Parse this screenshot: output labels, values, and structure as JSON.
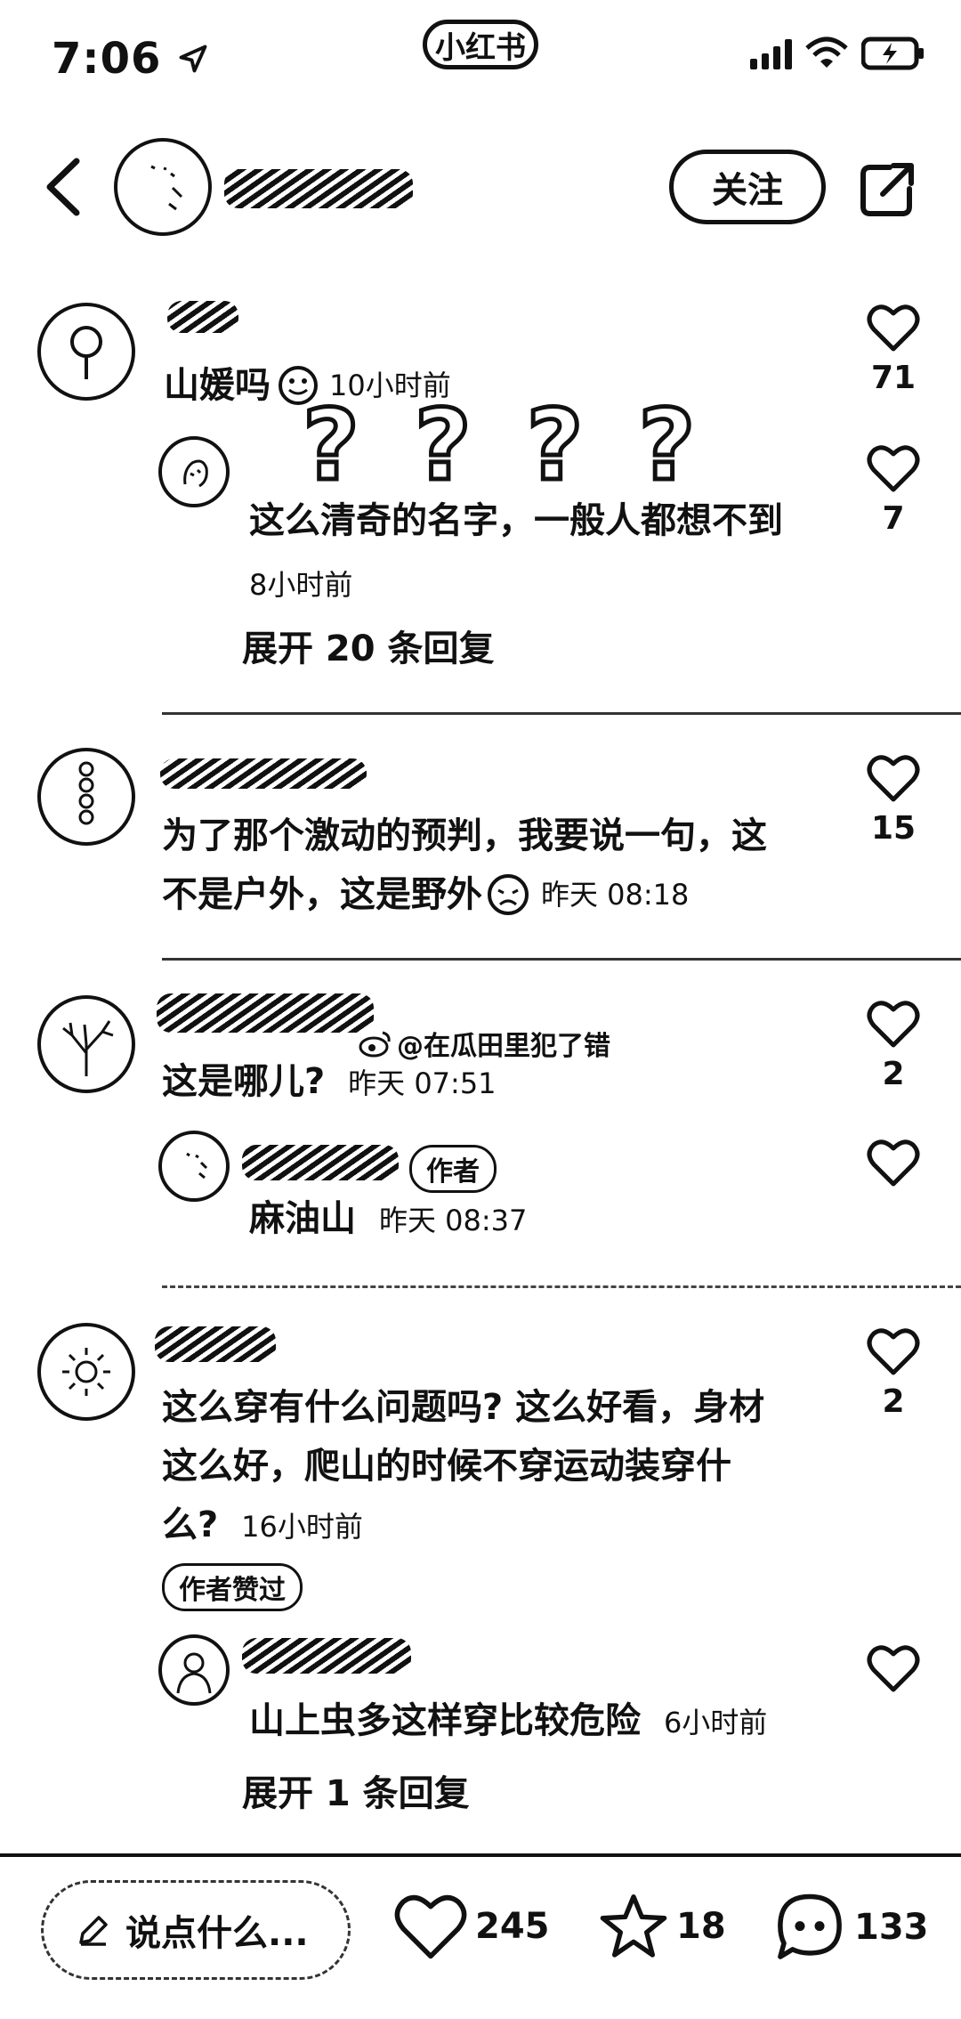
{
  "status_bar": {
    "time": "7:06",
    "app_badge": "小红书"
  },
  "header": {
    "follow_label": "关注"
  },
  "comments": [
    {
      "text": "山媛吗",
      "time": "10小时前",
      "likes": "71",
      "reply": {
        "text": "这么清奇的名字，一般人都想不到",
        "time": "8小时前",
        "likes": "7"
      },
      "expand": "展开 20 条回复"
    },
    {
      "text_line1": "为了那个激动的预判，我要说一句，这",
      "text_line2": "不是户外，这是野外",
      "time": "昨天 08:18",
      "likes": "15"
    },
    {
      "mention": "@在瓜田里犯了错",
      "text": "这是哪儿?",
      "time": "昨天 07:51",
      "likes": "2",
      "reply": {
        "badge": "作者",
        "text": "麻油山",
        "time": "昨天 08:37"
      }
    },
    {
      "text_line1": "这么穿有什么问题吗? 这么好看，身材",
      "text_line2": "这么好，爬山的时候不穿运动装穿什",
      "text_line3": "么?",
      "time": "16小时前",
      "likes": "2",
      "liked_badge": "作者赞过",
      "reply": {
        "text": "山上虫多这样穿比较危险",
        "time": "6小时前"
      },
      "expand": "展开 1 条回复"
    }
  ],
  "bottom_bar": {
    "input_placeholder": "说点什么...",
    "likes": "245",
    "stars": "18",
    "comments": "133"
  }
}
